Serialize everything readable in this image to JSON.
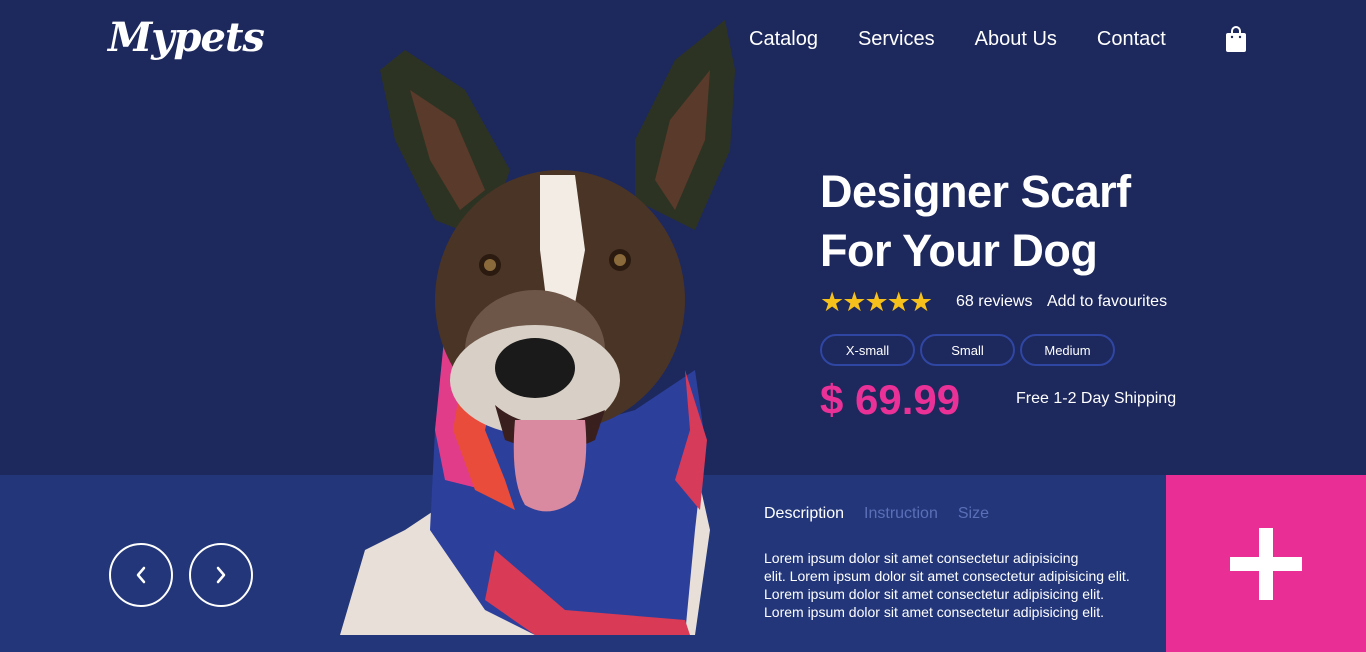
{
  "header": {
    "logo": "Mypets",
    "nav": [
      "Catalog",
      "Services",
      "About Us",
      "Contact"
    ],
    "cart_icon": "shopping-bag-icon"
  },
  "product": {
    "title_line1": "Designer Scarf",
    "title_line2": "For Your Dog",
    "rating": 5,
    "reviews": "68 reviews",
    "favourites": "Add to favourites",
    "sizes": [
      "X-small",
      "Small",
      "Medium"
    ],
    "price": "$ 69.99",
    "shipping": "Free 1-2 Day Shipping"
  },
  "details": {
    "tabs": [
      "Description",
      "Instruction",
      "Size"
    ],
    "active_tab": "Description",
    "lines": [
      "Lorem ipsum dolor sit amet consectetur adipisicing",
      "elit. Lorem ipsum dolor sit amet consectetur adipisicing elit.",
      "Lorem ipsum dolor sit amet consectetur adipisicing elit.",
      "Lorem ipsum dolor sit amet consectetur adipisicing elit."
    ]
  },
  "colors": {
    "background": "#1d285d",
    "band": "#223679",
    "accent": "#e92e96",
    "star": "#f7c11c"
  },
  "icons": {
    "prev": "chevron-left-icon",
    "next": "chevron-right-icon",
    "add": "plus-icon"
  }
}
